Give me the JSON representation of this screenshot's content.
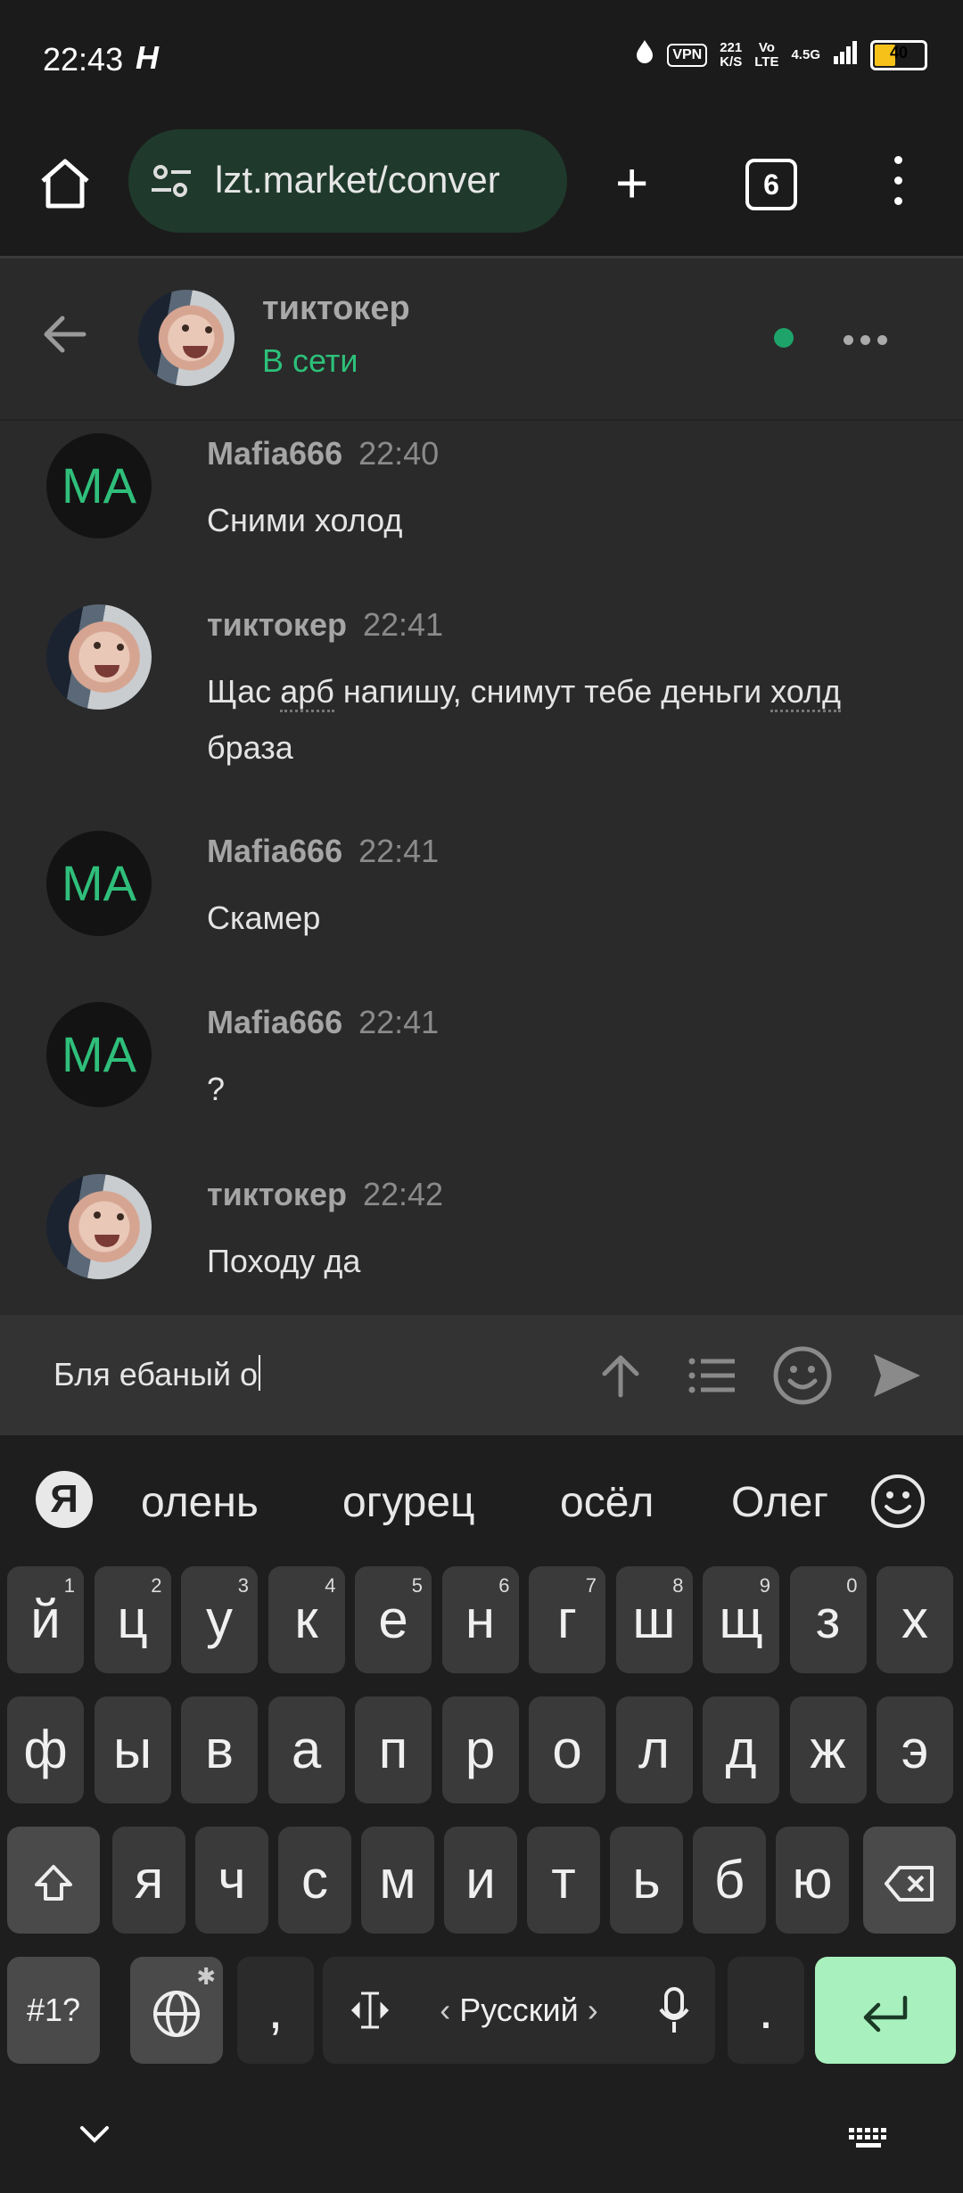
{
  "status_bar": {
    "time": "22:43",
    "extra_icon": "H",
    "vpn": "VPN",
    "speed_value": "221",
    "speed_unit": "K/S",
    "network_top": "Vo",
    "network_bottom": "LTE",
    "signal": "4.5G",
    "battery": "40",
    "battery_color": "#f6c21a"
  },
  "browser": {
    "url": "lzt.market/conver",
    "tab_count": "6"
  },
  "chat": {
    "contact_name": "тиктокер",
    "contact_status": "В сети",
    "status_color": "#2dc07a"
  },
  "messages": [
    {
      "author": "Mafia666",
      "avatar_initials": "MA",
      "time": "22:40",
      "text": "Сними холод"
    },
    {
      "author": "тиктокер",
      "time": "22:41",
      "text_parts": [
        "Щас ",
        "арб",
        " напишу, снимут тебе деньги ",
        "холд",
        " браза"
      ]
    },
    {
      "author": "Mafia666",
      "avatar_initials": "MA",
      "time": "22:41",
      "text": "Скамер"
    },
    {
      "author": "Mafia666",
      "avatar_initials": "MA",
      "time": "22:41",
      "text": "?"
    },
    {
      "author": "тиктокер",
      "time": "22:42",
      "text": "Походу да"
    }
  ],
  "composer": {
    "draft": "Бля ебаный о"
  },
  "keyboard": {
    "yandex_logo": "Я",
    "suggestions": [
      "олень",
      "огурец",
      "осёл",
      "Олег"
    ],
    "row1": [
      [
        "й",
        "1"
      ],
      [
        "ц",
        "2"
      ],
      [
        "у",
        "3"
      ],
      [
        "к",
        "4"
      ],
      [
        "е",
        "5"
      ],
      [
        "н",
        "6"
      ],
      [
        "г",
        "7"
      ],
      [
        "ш",
        "8"
      ],
      [
        "щ",
        "9"
      ],
      [
        "з",
        "0"
      ],
      [
        "х",
        ""
      ]
    ],
    "row2": [
      "ф",
      "ы",
      "в",
      "а",
      "п",
      "р",
      "о",
      "л",
      "д",
      "ж",
      "э"
    ],
    "row3": [
      "я",
      "ч",
      "с",
      "м",
      "и",
      "т",
      "ь",
      "б",
      "ю"
    ],
    "symbols_key": "#1?",
    "comma": ",",
    "language": "Русский",
    "lang_prev": "‹",
    "lang_next": "›",
    "period": "."
  },
  "icons": [
    "home-icon",
    "tune-icon",
    "plus-icon",
    "tabs-icon",
    "menu-icon",
    "back-arrow-icon",
    "more-icon",
    "send-up-icon",
    "list-icon",
    "smile-icon",
    "send-icon",
    "shift-icon",
    "backspace-icon",
    "globe-icon",
    "cursor-icon",
    "mic-icon",
    "enter-icon",
    "chevron-down-icon",
    "keyboard-icon"
  ]
}
